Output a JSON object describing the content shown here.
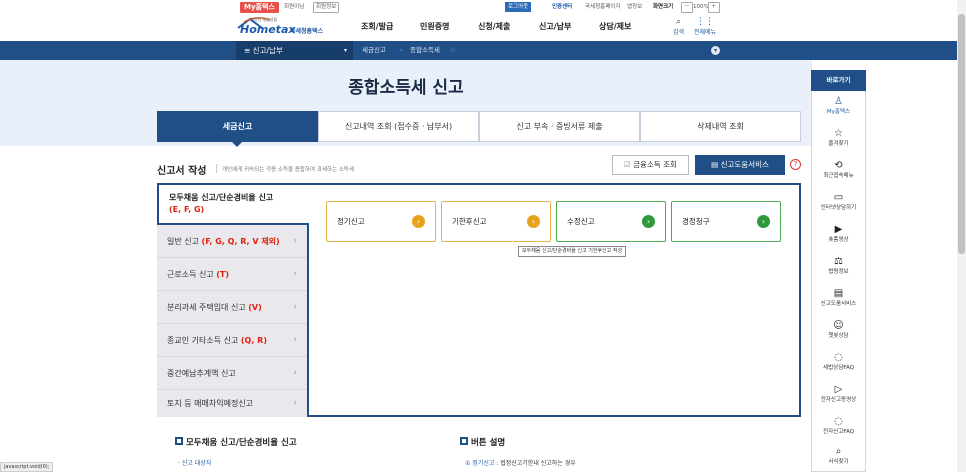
{
  "topbar": {
    "my_badge": "My홈택스",
    "welcome": "회원이님",
    "signup": "회원정보",
    "login": "로그아웃",
    "cert": "인증센터",
    "links": [
      "국세청홈페이지",
      "앱정보",
      "화면크기"
    ],
    "zoom": "100%"
  },
  "logo": {
    "title": "Hometax",
    "subtitle": "국세청홈택스",
    "tagline": "편리한 세금생활"
  },
  "gnb": {
    "items": [
      "조회/발급",
      "민원증명",
      "신청/제출",
      "신고/납부",
      "상담/제보"
    ],
    "search": "검색",
    "allmenu": "전체메뉴"
  },
  "nav": {
    "selected": "신고/납부",
    "crumbs": [
      "세금신고",
      "종합소득세"
    ]
  },
  "page_title": "종합소득세 신고",
  "tabs": [
    {
      "label": "세금신고",
      "active": true
    },
    {
      "label": "신고내역 조회 (접수증 · 납부서)"
    },
    {
      "label": "신고 부속 · 증빙서류 제출"
    },
    {
      "label": "삭제내역 조회"
    }
  ],
  "section": {
    "title": "신고서 작성",
    "desc": "개인에게 귀속되는 각종 소득을 종합하여 과세하는 소득세",
    "btn_finance": "금융소득 조회",
    "btn_help": "신고도움서비스",
    "help_icon": "?"
  },
  "left_menu": {
    "head": {
      "label": "모두채움 신고/단순경비율 신고",
      "badge": "(E, F, G)"
    },
    "items": [
      {
        "label": "일반 신고",
        "badge": "(F, G, Q, R, V 제외)"
      },
      {
        "label": "근로소득 신고",
        "badge": "(T)"
      },
      {
        "label": "분리과세 주택임대 신고",
        "badge": "(V)"
      },
      {
        "label": "종교인 기타소득 신고",
        "badge": "(Q, R)"
      },
      {
        "label": "중간예납추계액 신고",
        "badge": ""
      },
      {
        "label": "토지 등 매매차익예정신고",
        "badge": ""
      }
    ]
  },
  "cards": [
    {
      "label": "정기신고",
      "color": "#e8a21c"
    },
    {
      "label": "기한후신고",
      "color": "#e8a21c"
    },
    {
      "label": "수정신고",
      "color": "#2f9a3a"
    },
    {
      "label": "경정청구",
      "color": "#2f9a3a"
    }
  ],
  "tooltip": "모두채움 신고/단순경비율 신고 기한후신고 작성",
  "bottom": {
    "left_title": "모두채움 신고/단순경비율 신고",
    "left_sub": "신고 대상자",
    "right_title": "버튼 설명",
    "right_sub_label": "① 정기신고",
    "right_sub_text": " : 법정신고기한내 신고하는 경우"
  },
  "sidebar": {
    "title": "바로가기",
    "items": [
      {
        "label": "My홈택스",
        "icon": "person-icon",
        "glyph": "♙"
      },
      {
        "label": "즐겨찾기",
        "icon": "star-icon",
        "glyph": "☆"
      },
      {
        "label": "최근접속메뉴",
        "icon": "recent-icon",
        "glyph": "⟲"
      },
      {
        "label": "인터넷상담하기",
        "icon": "monitor-icon",
        "glyph": "▭"
      },
      {
        "label": "숏폼영상",
        "icon": "play-icon",
        "glyph": "▶"
      },
      {
        "label": "법령정보",
        "icon": "gavel-icon",
        "glyph": "⚖"
      },
      {
        "label": "신고도움서비스",
        "icon": "book-icon",
        "glyph": "▤"
      },
      {
        "label": "챗봇상담",
        "icon": "chatbot-icon",
        "glyph": "☺"
      },
      {
        "label": "세법상담FAQ",
        "icon": "faq-icon",
        "glyph": "◌"
      },
      {
        "label": "전자신고동영상",
        "icon": "video-icon",
        "glyph": "▷"
      },
      {
        "label": "전자신고FAQ",
        "icon": "faq2-icon",
        "glyph": "◌"
      },
      {
        "label": "서식찾기",
        "icon": "search-icon",
        "glyph": "⌕"
      }
    ]
  },
  "status": "javascript:void(0);"
}
